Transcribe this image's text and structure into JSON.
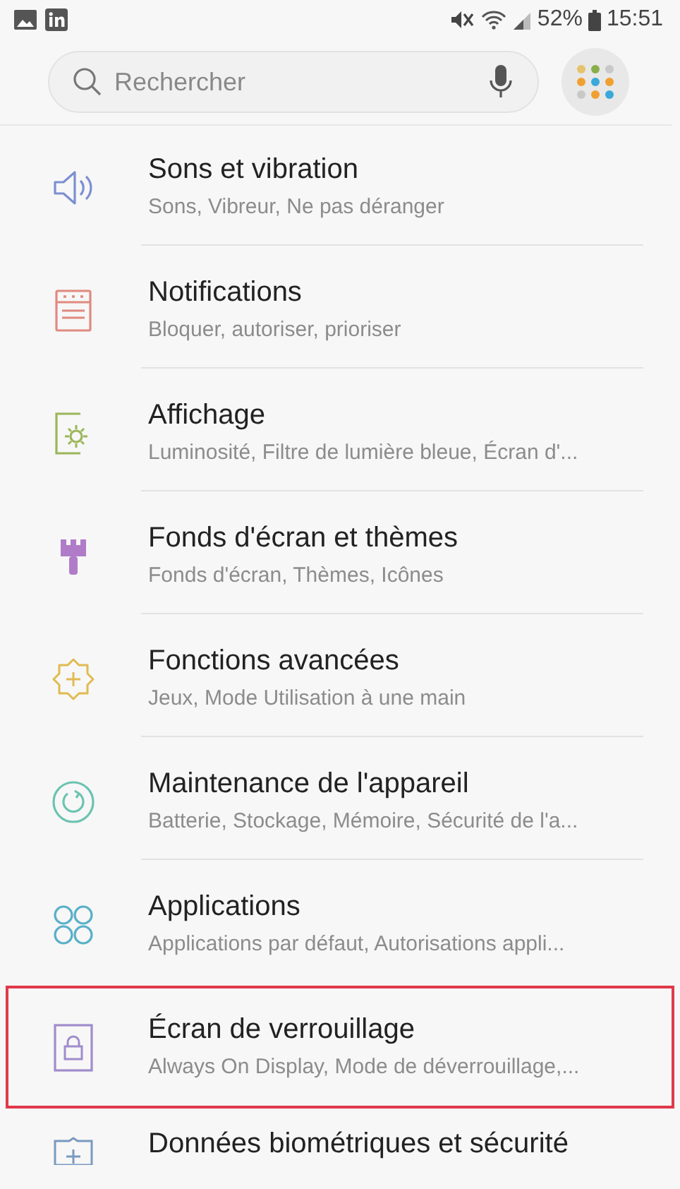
{
  "status_bar": {
    "battery": "52%",
    "time": "15:51"
  },
  "search": {
    "placeholder": "Rechercher"
  },
  "items": [
    {
      "kind": "sound",
      "title": "Sons et vibration",
      "subtitle": "Sons, Vibreur, Ne pas déranger",
      "highlighted": false
    },
    {
      "kind": "notifications",
      "title": "Notifications",
      "subtitle": "Bloquer, autoriser, prioriser",
      "highlighted": false
    },
    {
      "kind": "display",
      "title": "Affichage",
      "subtitle": "Luminosité, Filtre de lumière bleue, Écran d'...",
      "highlighted": false
    },
    {
      "kind": "wallpaper",
      "title": "Fonds d'écran et thèmes",
      "subtitle": "Fonds d'écran, Thèmes, Icônes",
      "highlighted": false
    },
    {
      "kind": "advanced",
      "title": "Fonctions avancées",
      "subtitle": "Jeux, Mode Utilisation à une main",
      "highlighted": false
    },
    {
      "kind": "maintenance",
      "title": "Maintenance de l'appareil",
      "subtitle": "Batterie, Stockage, Mémoire, Sécurité de l'a...",
      "highlighted": false
    },
    {
      "kind": "apps",
      "title": "Applications",
      "subtitle": "Applications par défaut, Autorisations appli...",
      "highlighted": false
    },
    {
      "kind": "lock",
      "title": "Écran de verrouillage",
      "subtitle": "Always On Display, Mode de déverrouillage,...",
      "highlighted": true
    },
    {
      "kind": "security",
      "title": "Données biométriques et sécurité",
      "highlighted": false
    }
  ]
}
